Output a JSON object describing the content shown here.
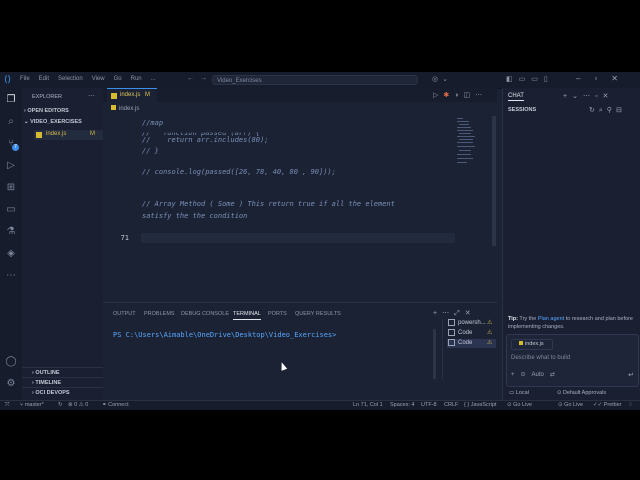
{
  "titlebar": {
    "menu": [
      "File",
      "Edit",
      "Selection",
      "View",
      "Go",
      "Run",
      "..."
    ],
    "search": "Video_Exercises"
  },
  "sidebar": {
    "title": "EXPLORER",
    "open_editors": "OPEN EDITORS",
    "folder": "VIDEO_EXERCISES",
    "file": {
      "name": "index.js",
      "status": "M"
    },
    "outline": "OUTLINE",
    "timeline": "TIMELINE",
    "oci": "OCI DEVOPS"
  },
  "editor": {
    "tab": {
      "name": "index.js",
      "status": "M"
    },
    "breadcrumb": "index.js",
    "lines": [
      {
        "n": "",
        "text": "//map"
      },
      {
        "n": "",
        "text": "//   function passed (arr) {"
      },
      {
        "n": "",
        "text": "//    return arr.includes(80);"
      },
      {
        "n": "",
        "text": "// }"
      },
      {
        "n": "",
        "text": ""
      },
      {
        "n": "",
        "text": "// console.log(passed([26, 78, 40, 80 , 90]));"
      },
      {
        "n": "",
        "text": ""
      },
      {
        "n": "",
        "text": ""
      },
      {
        "n": "",
        "text": "// Array Method ( Some ) This return true if all the element"
      },
      {
        "n": "",
        "text": "satisfy the the condition"
      },
      {
        "n": "",
        "text": ""
      },
      {
        "n": "",
        "text": ""
      },
      {
        "n": "71",
        "text": ""
      },
      {
        "n": "",
        "text": ""
      },
      {
        "n": "",
        "text": ""
      },
      {
        "n": "",
        "text": ""
      },
      {
        "n": "",
        "text": ""
      }
    ]
  },
  "panel": {
    "tabs": [
      "OUTPUT",
      "PROBLEMS",
      "DEBUG CONSOLE",
      "TERMINAL",
      "PORTS",
      "QUERY RESULTS"
    ],
    "prompt": "PS C:\\Users\\Aimable\\OneDrive\\Desktop\\Video_Exercises>",
    "terminals": [
      "powersh...",
      "Code",
      "Code"
    ]
  },
  "chat": {
    "title": "CHAT",
    "sessions": "SESSIONS",
    "tip_bold": "Tip:",
    "tip_pre": " Try the ",
    "tip_link": "Plan agent",
    "tip_post": " to research and plan before implementing changes.",
    "attachment": "index.js",
    "placeholder": "Describe what to build",
    "mode": "Auto",
    "footer_local": "Local",
    "footer_approvals": "Default Approvals"
  },
  "status": {
    "branch": "master*",
    "errors": "0",
    "warnings": "0",
    "connect": "Connect",
    "position": "Ln 71, Col 1",
    "spaces": "Spaces: 4",
    "encoding": "UTF-8",
    "eol": "CRLF",
    "language": "JavaScript",
    "golive1": "Go Live",
    "golive2": "Go Live",
    "prettier": "Prettier"
  }
}
